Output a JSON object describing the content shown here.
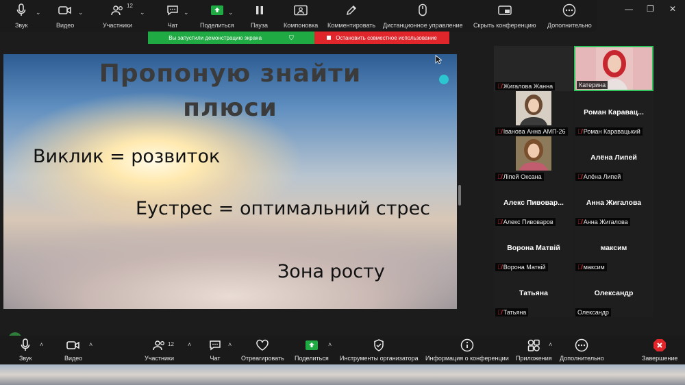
{
  "toolbar": {
    "audio": "Звук",
    "video": "Видео",
    "participants": "Участники",
    "participants_count": "12",
    "chat": "Чат",
    "share": "Поделиться",
    "pause": "Пауза",
    "layout": "Компоновка",
    "annotate": "Комментировать",
    "remote": "Дистанционное управление",
    "hide": "Скрыть конференцию",
    "more": "Дополнительно"
  },
  "banner": {
    "sharing": "Вы запустили демонстрацию экрана",
    "stop": "Остановить совместное использование"
  },
  "slide": {
    "title_line1": "Пропоную знайти",
    "title_line2": "плюси",
    "line1": "Виклик = розвиток",
    "line2": "Еустрес = оптимальний стрес",
    "line3": "Зона росту"
  },
  "participants": [
    {
      "name": "",
      "label": "Жигалова Жанна",
      "muted": true
    },
    {
      "name": "",
      "label": "Катерина",
      "muted": false
    },
    {
      "name": "",
      "label": "Іванова Анна АМП-26",
      "muted": true
    },
    {
      "name": "Роман  Каравац...",
      "label": "Роман Каравацький",
      "muted": true
    },
    {
      "name": "",
      "label": "Ліпей Оксана",
      "muted": true
    },
    {
      "name": "Алёна Липей",
      "label": "Алёна Липей",
      "muted": true
    },
    {
      "name": "Алекс  Пивовар...",
      "label": "Алекс Пивоваров",
      "muted": true
    },
    {
      "name": "Анна Жигалова",
      "label": "Анна Жигалова",
      "muted": true
    },
    {
      "name": "Ворона Матвій",
      "label": "Ворона Матвій",
      "muted": true
    },
    {
      "name": "максим",
      "label": "максим",
      "muted": true
    },
    {
      "name": "Татьяна",
      "label": "Татьяна",
      "muted": true
    },
    {
      "name": "Олександр",
      "label": "Олександр",
      "muted": false
    }
  ],
  "bottom": {
    "audio": "Звук",
    "video": "Видео",
    "participants": "Участники",
    "participants_count": "12",
    "chat": "Чат",
    "react": "Отреагировать",
    "share": "Поделиться",
    "host_tools": "Инструменты организатора",
    "info": "Информация о конференции",
    "apps": "Приложения",
    "more": "Дополнительно",
    "end": "Завершение"
  },
  "colors": {
    "share_green": "#1faa43",
    "stop_red": "#e0252b",
    "active_border": "#31c45c",
    "end_red": "#e0252b"
  }
}
